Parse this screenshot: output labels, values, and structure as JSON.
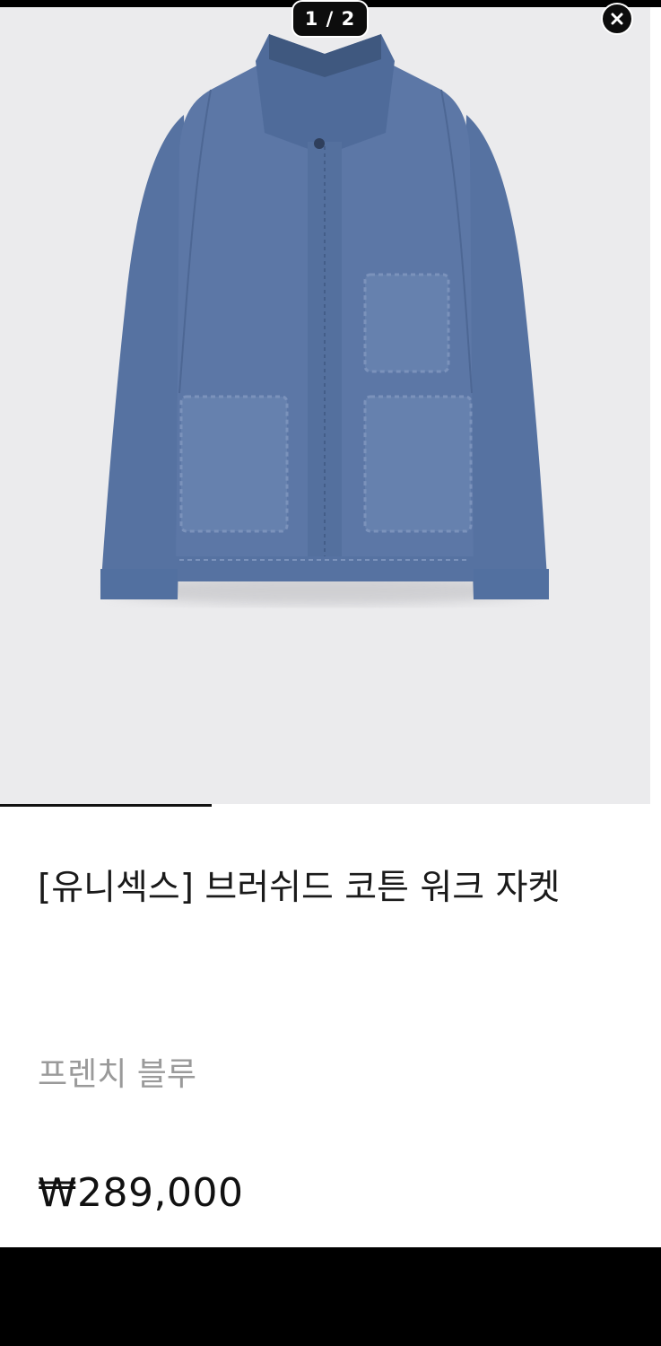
{
  "viewer": {
    "counter": "1 / 2",
    "current_slide": 1,
    "total_slides": 2,
    "progress_fraction": 0.32,
    "close_icon": "close-icon"
  },
  "product": {
    "image_subject": "jacket-image",
    "title": "[유니섹스] 브러쉬드 코튼 워크 자켓",
    "color_name": "프렌치 블루",
    "price": "₩289,000"
  },
  "colors": {
    "overlay": "#000000",
    "image_background": "#ebebed",
    "jacket": "#5a74a3",
    "color_text": "#9a9a9a",
    "price_text": "#111111"
  }
}
